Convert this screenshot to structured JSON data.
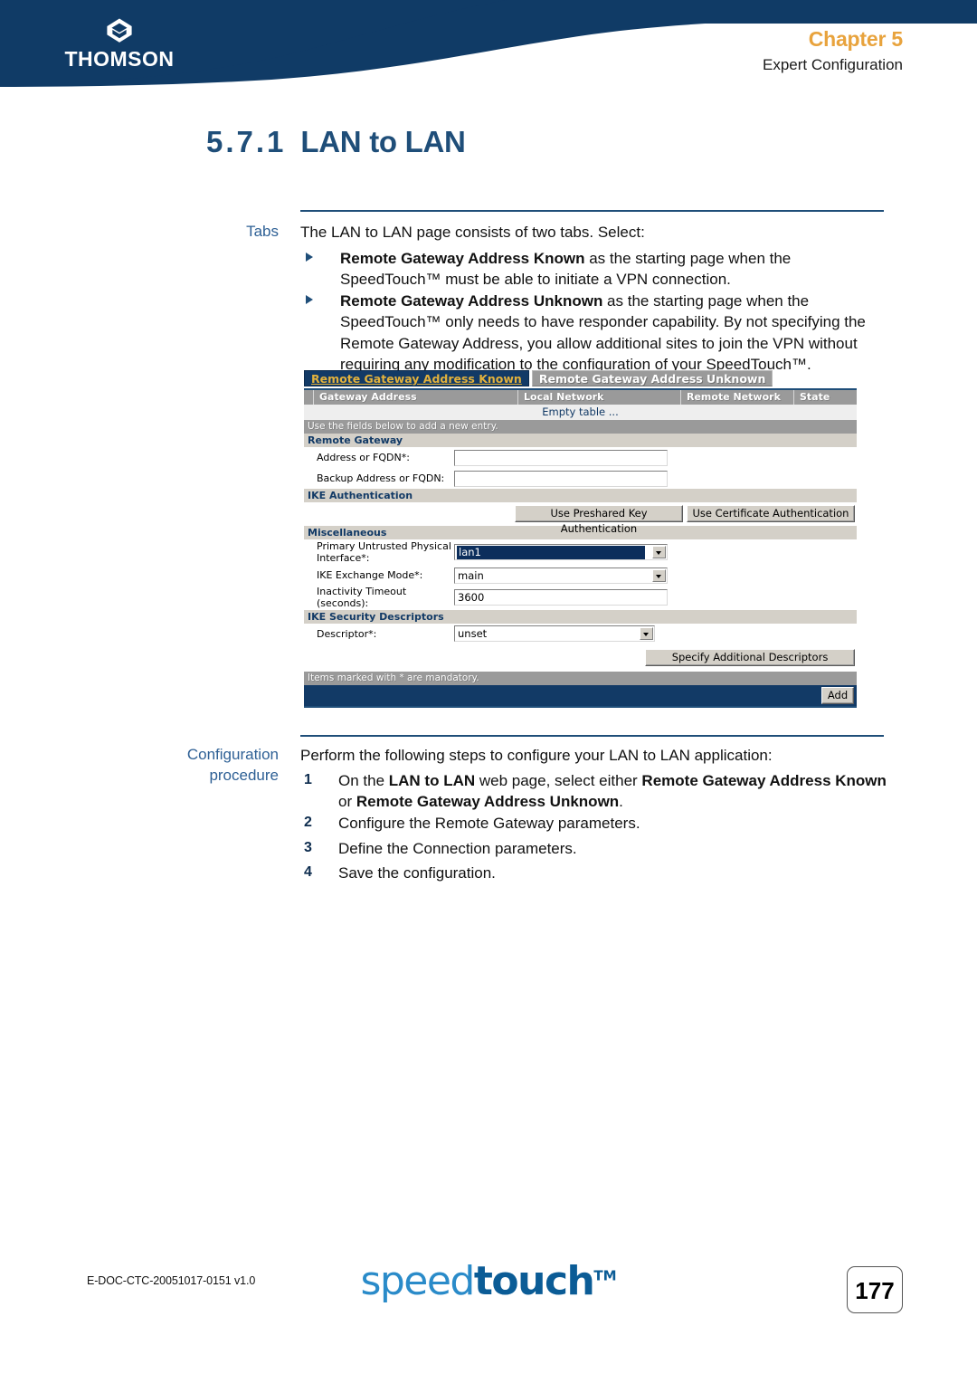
{
  "header": {
    "brand": "THOMSON",
    "brand_mark": "thomson-diamond-logo",
    "chapter": "Chapter 5",
    "chapter_subtitle": "Expert Configuration",
    "accent_color": "#E8A33D",
    "bg_color": "#103B66"
  },
  "title": {
    "number": "5.7.1",
    "text": "LAN to LAN"
  },
  "tabs_section": {
    "margin_label": "Tabs",
    "intro": "The LAN to LAN page consists of two tabs. Select:",
    "bullets": [
      {
        "bold": "Remote Gateway Address Known",
        "rest": " as the starting page when the SpeedTouch™ must be able to initiate a VPN connection."
      },
      {
        "bold": "Remote Gateway Address Unknown",
        "rest": " as the starting page when the SpeedTouch™ only needs to have responder capability. By not specifying the Remote Gateway Address, you allow additional sites to join the VPN without requiring any modification to the configuration of your SpeedTouch™."
      }
    ]
  },
  "screenshot": {
    "tabs": [
      {
        "label": "Remote Gateway Address Known",
        "active": true
      },
      {
        "label": "Remote Gateway Address Unknown",
        "active": false
      }
    ],
    "table": {
      "columns": [
        "Gateway Address",
        "Local Network",
        "Remote Network",
        "State"
      ],
      "empty_text": "Empty table ...",
      "hint": "Use the fields below to add a new entry."
    },
    "sections": [
      {
        "title": "Remote Gateway",
        "fields": [
          {
            "label": "Address or FQDN*:",
            "type": "text",
            "value": ""
          },
          {
            "label": "Backup Address or FQDN:",
            "type": "text",
            "value": ""
          }
        ]
      },
      {
        "title": "IKE Authentication",
        "buttons": [
          "Use Preshared Key Authentication",
          "Use Certificate Authentication"
        ]
      },
      {
        "title": "Miscellaneous",
        "fields": [
          {
            "label": "Primary Untrusted Physical Interface*:",
            "type": "select",
            "value": "lan1",
            "focused": true
          },
          {
            "label": "IKE Exchange Mode*:",
            "type": "select",
            "value": "main",
            "focused": false
          },
          {
            "label": "Inactivity Timeout (seconds):",
            "type": "text",
            "value": "3600"
          }
        ]
      },
      {
        "title": "IKE Security Descriptors",
        "fields": [
          {
            "label": "Descriptor*:",
            "type": "select",
            "value": "unset",
            "focused": false
          }
        ],
        "buttons": [
          "Specify Additional Descriptors"
        ]
      }
    ],
    "mandatory_note": "Items marked with * are mandatory.",
    "add_button": "Add"
  },
  "procedure": {
    "margin_label_line1": "Configuration",
    "margin_label_line2": "procedure",
    "intro": "Perform the following steps to configure your LAN to LAN application:",
    "steps": [
      {
        "num": "1",
        "text_parts": [
          "On the ",
          "LAN to LAN",
          " web page, select either ",
          "Remote Gateway Address Known",
          " or ",
          "Remote Gateway Address Unknown",
          "."
        ]
      },
      {
        "num": "2",
        "text_parts": [
          "Configure the Remote Gateway parameters."
        ]
      },
      {
        "num": "3",
        "text_parts": [
          "Define the Connection parameters."
        ]
      },
      {
        "num": "4",
        "text_parts": [
          "Save the configuration."
        ]
      }
    ]
  },
  "footer": {
    "doc_id": "E-DOC-CTC-20051017-0151 v1.0",
    "logo_thin": "speed",
    "logo_thick": "touch",
    "logo_tm": "TM",
    "page_number": "177"
  }
}
